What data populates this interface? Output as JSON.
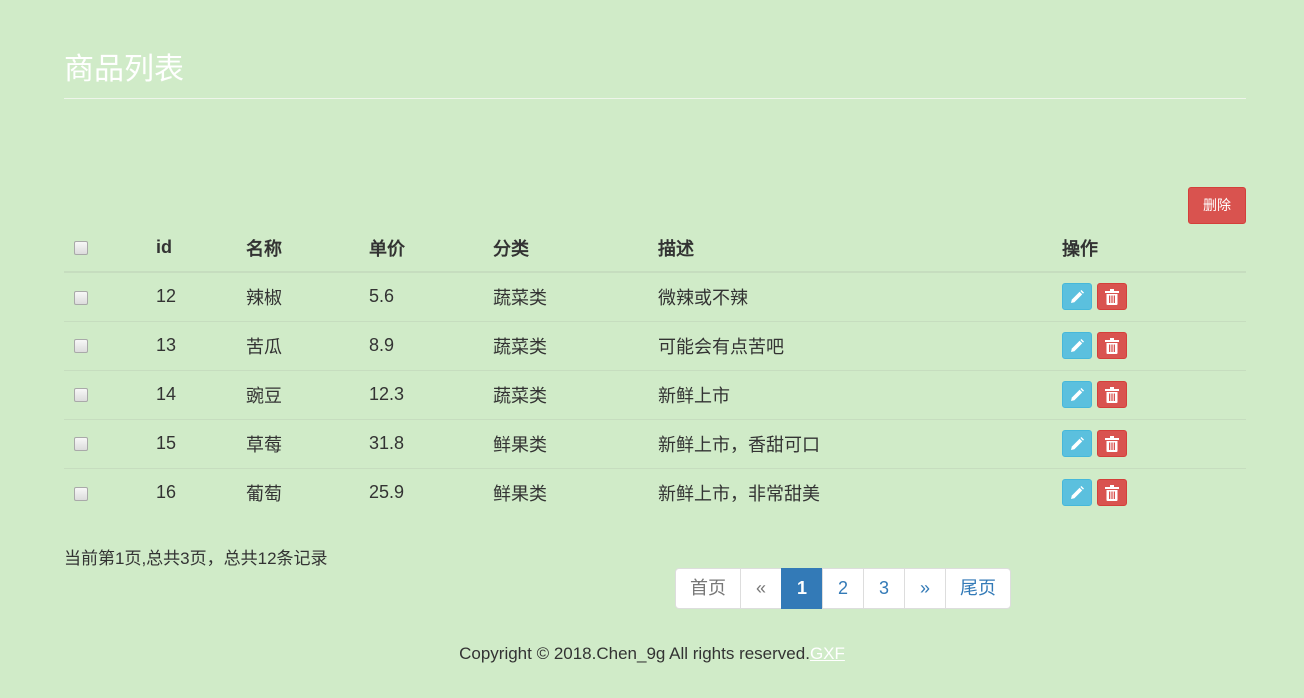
{
  "page": {
    "title": "商品列表"
  },
  "toolbar": {
    "delete_label": "删除"
  },
  "table": {
    "headers": {
      "id": "id",
      "name": "名称",
      "price": "单价",
      "category": "分类",
      "description": "描述",
      "actions": "操作"
    },
    "rows": [
      {
        "id": "12",
        "name": "辣椒",
        "price": "5.6",
        "category": "蔬菜类",
        "description": "微辣或不辣"
      },
      {
        "id": "13",
        "name": "苦瓜",
        "price": "8.9",
        "category": "蔬菜类",
        "description": "可能会有点苦吧"
      },
      {
        "id": "14",
        "name": "豌豆",
        "price": "12.3",
        "category": "蔬菜类",
        "description": "新鲜上市"
      },
      {
        "id": "15",
        "name": "草莓",
        "price": "31.8",
        "category": "鲜果类",
        "description": "新鲜上市，香甜可口"
      },
      {
        "id": "16",
        "name": "葡萄",
        "price": "25.9",
        "category": "鲜果类",
        "description": "新鲜上市，非常甜美"
      }
    ],
    "row_actions": [
      "pencil-icon",
      "trash-icon"
    ]
  },
  "pagination": {
    "summary": "当前第1页,总共3页，总共12条记录",
    "first": "首页",
    "prev": "«",
    "pages": [
      "1",
      "2",
      "3"
    ],
    "current_page": "1",
    "next": "»",
    "last": "尾页"
  },
  "footer": {
    "copyright": "Copyright © 2018.Chen_9g All rights reserved.",
    "link": "GXF"
  },
  "colors": {
    "background": "#d0ebc8",
    "primary": "#337ab7",
    "danger": "#d9534f",
    "info": "#5bc0de"
  }
}
